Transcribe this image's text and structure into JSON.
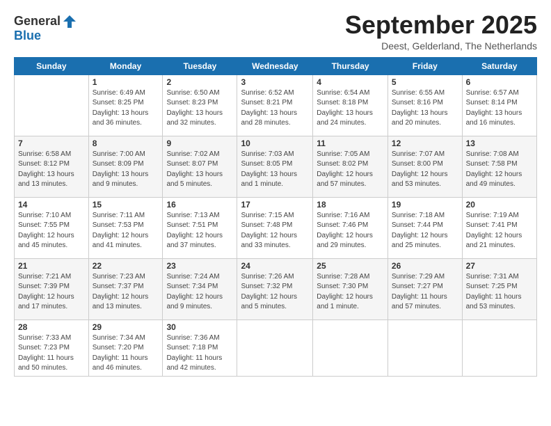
{
  "header": {
    "logo_line1": "General",
    "logo_line2": "Blue",
    "month": "September 2025",
    "location": "Deest, Gelderland, The Netherlands"
  },
  "weekdays": [
    "Sunday",
    "Monday",
    "Tuesday",
    "Wednesday",
    "Thursday",
    "Friday",
    "Saturday"
  ],
  "weeks": [
    [
      {
        "day": "",
        "info": ""
      },
      {
        "day": "1",
        "info": "Sunrise: 6:49 AM\nSunset: 8:25 PM\nDaylight: 13 hours\nand 36 minutes."
      },
      {
        "day": "2",
        "info": "Sunrise: 6:50 AM\nSunset: 8:23 PM\nDaylight: 13 hours\nand 32 minutes."
      },
      {
        "day": "3",
        "info": "Sunrise: 6:52 AM\nSunset: 8:21 PM\nDaylight: 13 hours\nand 28 minutes."
      },
      {
        "day": "4",
        "info": "Sunrise: 6:54 AM\nSunset: 8:18 PM\nDaylight: 13 hours\nand 24 minutes."
      },
      {
        "day": "5",
        "info": "Sunrise: 6:55 AM\nSunset: 8:16 PM\nDaylight: 13 hours\nand 20 minutes."
      },
      {
        "day": "6",
        "info": "Sunrise: 6:57 AM\nSunset: 8:14 PM\nDaylight: 13 hours\nand 16 minutes."
      }
    ],
    [
      {
        "day": "7",
        "info": "Sunrise: 6:58 AM\nSunset: 8:12 PM\nDaylight: 13 hours\nand 13 minutes."
      },
      {
        "day": "8",
        "info": "Sunrise: 7:00 AM\nSunset: 8:09 PM\nDaylight: 13 hours\nand 9 minutes."
      },
      {
        "day": "9",
        "info": "Sunrise: 7:02 AM\nSunset: 8:07 PM\nDaylight: 13 hours\nand 5 minutes."
      },
      {
        "day": "10",
        "info": "Sunrise: 7:03 AM\nSunset: 8:05 PM\nDaylight: 13 hours\nand 1 minute."
      },
      {
        "day": "11",
        "info": "Sunrise: 7:05 AM\nSunset: 8:02 PM\nDaylight: 12 hours\nand 57 minutes."
      },
      {
        "day": "12",
        "info": "Sunrise: 7:07 AM\nSunset: 8:00 PM\nDaylight: 12 hours\nand 53 minutes."
      },
      {
        "day": "13",
        "info": "Sunrise: 7:08 AM\nSunset: 7:58 PM\nDaylight: 12 hours\nand 49 minutes."
      }
    ],
    [
      {
        "day": "14",
        "info": "Sunrise: 7:10 AM\nSunset: 7:55 PM\nDaylight: 12 hours\nand 45 minutes."
      },
      {
        "day": "15",
        "info": "Sunrise: 7:11 AM\nSunset: 7:53 PM\nDaylight: 12 hours\nand 41 minutes."
      },
      {
        "day": "16",
        "info": "Sunrise: 7:13 AM\nSunset: 7:51 PM\nDaylight: 12 hours\nand 37 minutes."
      },
      {
        "day": "17",
        "info": "Sunrise: 7:15 AM\nSunset: 7:48 PM\nDaylight: 12 hours\nand 33 minutes."
      },
      {
        "day": "18",
        "info": "Sunrise: 7:16 AM\nSunset: 7:46 PM\nDaylight: 12 hours\nand 29 minutes."
      },
      {
        "day": "19",
        "info": "Sunrise: 7:18 AM\nSunset: 7:44 PM\nDaylight: 12 hours\nand 25 minutes."
      },
      {
        "day": "20",
        "info": "Sunrise: 7:19 AM\nSunset: 7:41 PM\nDaylight: 12 hours\nand 21 minutes."
      }
    ],
    [
      {
        "day": "21",
        "info": "Sunrise: 7:21 AM\nSunset: 7:39 PM\nDaylight: 12 hours\nand 17 minutes."
      },
      {
        "day": "22",
        "info": "Sunrise: 7:23 AM\nSunset: 7:37 PM\nDaylight: 12 hours\nand 13 minutes."
      },
      {
        "day": "23",
        "info": "Sunrise: 7:24 AM\nSunset: 7:34 PM\nDaylight: 12 hours\nand 9 minutes."
      },
      {
        "day": "24",
        "info": "Sunrise: 7:26 AM\nSunset: 7:32 PM\nDaylight: 12 hours\nand 5 minutes."
      },
      {
        "day": "25",
        "info": "Sunrise: 7:28 AM\nSunset: 7:30 PM\nDaylight: 12 hours\nand 1 minute."
      },
      {
        "day": "26",
        "info": "Sunrise: 7:29 AM\nSunset: 7:27 PM\nDaylight: 11 hours\nand 57 minutes."
      },
      {
        "day": "27",
        "info": "Sunrise: 7:31 AM\nSunset: 7:25 PM\nDaylight: 11 hours\nand 53 minutes."
      }
    ],
    [
      {
        "day": "28",
        "info": "Sunrise: 7:33 AM\nSunset: 7:23 PM\nDaylight: 11 hours\nand 50 minutes."
      },
      {
        "day": "29",
        "info": "Sunrise: 7:34 AM\nSunset: 7:20 PM\nDaylight: 11 hours\nand 46 minutes."
      },
      {
        "day": "30",
        "info": "Sunrise: 7:36 AM\nSunset: 7:18 PM\nDaylight: 11 hours\nand 42 minutes."
      },
      {
        "day": "",
        "info": ""
      },
      {
        "day": "",
        "info": ""
      },
      {
        "day": "",
        "info": ""
      },
      {
        "day": "",
        "info": ""
      }
    ]
  ]
}
